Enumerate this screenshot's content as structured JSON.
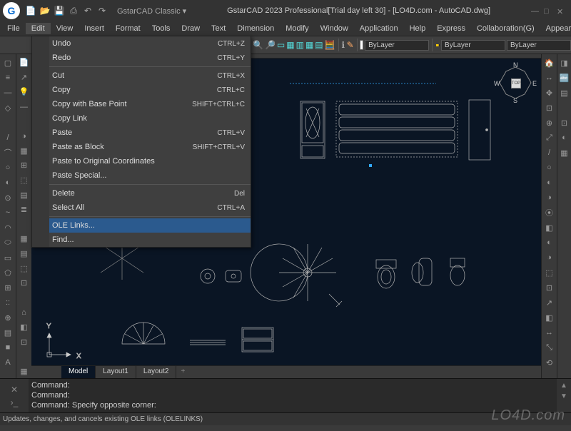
{
  "title": "GstarCAD 2023 Professional[Trial day left 30] - [LO4D.com - AutoCAD.dwg]",
  "workspace": "GstarCAD Classic",
  "logo_text": "G",
  "menubar": [
    "File",
    "Edit",
    "View",
    "Insert",
    "Format",
    "Tools",
    "Draw",
    "Text",
    "Dimension",
    "Modify",
    "Window",
    "Application",
    "Help",
    "Express",
    "Collaboration(G)",
    "Appearance"
  ],
  "active_menu_index": 1,
  "dropdown": [
    {
      "icon": "↶",
      "icon_class": "ic-blue",
      "label": "Undo",
      "shortcut": "CTRL+Z"
    },
    {
      "icon": "↷",
      "icon_class": "ic-yellow",
      "label": "Redo",
      "shortcut": "CTRL+Y"
    },
    {
      "sep": true
    },
    {
      "icon": "✂",
      "icon_class": "",
      "label": "Cut",
      "shortcut": "CTRL+X"
    },
    {
      "icon": "📋",
      "icon_class": "",
      "label": "Copy",
      "shortcut": "CTRL+C"
    },
    {
      "icon": "📋",
      "icon_class": "",
      "label": "Copy with Base Point",
      "shortcut": "SHIFT+CTRL+C"
    },
    {
      "icon": "🔗",
      "icon_class": "",
      "label": "Copy Link",
      "shortcut": ""
    },
    {
      "icon": "📄",
      "icon_class": "",
      "label": "Paste",
      "shortcut": "CTRL+V"
    },
    {
      "icon": "▣",
      "icon_class": "",
      "label": "Paste as Block",
      "shortcut": "SHIFT+CTRL+V"
    },
    {
      "icon": "▤",
      "icon_class": "",
      "label": "Paste to Original Coordinates",
      "shortcut": ""
    },
    {
      "icon": "",
      "icon_class": "",
      "label": "Paste Special...",
      "shortcut": ""
    },
    {
      "sep": true
    },
    {
      "icon": "◆",
      "icon_class": "ic-blue",
      "label": "Delete",
      "shortcut": "Del"
    },
    {
      "icon": "▭",
      "icon_class": "",
      "label": "Select All",
      "shortcut": "CTRL+A"
    },
    {
      "sep": true
    },
    {
      "icon": "",
      "icon_class": "",
      "label": "OLE Links...",
      "shortcut": "",
      "hover": true
    },
    {
      "icon": "🔍",
      "icon_class": "",
      "label": "Find...",
      "shortcut": ""
    }
  ],
  "toolbar_icons": [
    "🔍",
    "🔎",
    "▭",
    "▦",
    "▥",
    "▦",
    "▤",
    "🧮"
  ],
  "toolbar_icons2": [
    "ℹ",
    "✎"
  ],
  "layer_boxes": [
    "ByLayer",
    "ByLayer",
    "ByLayer"
  ],
  "left_tools": [
    "▢",
    "≡",
    "—",
    "◇",
    "",
    "/",
    "⌒",
    "○",
    "◐",
    "⊙",
    "~",
    "◠",
    "⬭",
    "▭",
    "⬠",
    "⊞",
    "::",
    "⊕",
    "▤",
    "■",
    "A"
  ],
  "left_tools2": [
    "📄",
    "↗",
    "💡",
    "—",
    "",
    "◑",
    "▦",
    "⊞",
    "⬚",
    "▤",
    "≣",
    "",
    "▦",
    "▤",
    "⬚",
    "⊡",
    "",
    "⌂",
    "◧",
    "⊡",
    "",
    "▦"
  ],
  "right_tools": [
    "🏠",
    "↔",
    "✥",
    "⊡",
    "⊕",
    "⤢",
    "/",
    "○",
    "◐",
    "◑",
    "⦿",
    "◧",
    "◐",
    "◑",
    "⬚",
    "⊡",
    "↗",
    "◧",
    "↔",
    "⤡",
    "⟲"
  ],
  "right_tools2": [
    "◨",
    "🔤",
    "▤",
    "",
    "⊡",
    "◐",
    "▦"
  ],
  "compass": {
    "n": "N",
    "s": "S",
    "e": "E",
    "w": "W",
    "top": "TOP"
  },
  "layout_tabs": {
    "tabs": [
      "Model",
      "Layout1",
      "Layout2"
    ],
    "active": 0
  },
  "cmdlines": [
    "Command:",
    "Command:",
    "Command: Specify opposite corner:"
  ],
  "statusbar": "Updates, changes, and cancels existing OLE links (OLELINKS)",
  "watermark": "LO4D.com",
  "qat_icons": [
    "📄",
    "📂",
    "💾",
    "⎙",
    "↶",
    "↷"
  ]
}
